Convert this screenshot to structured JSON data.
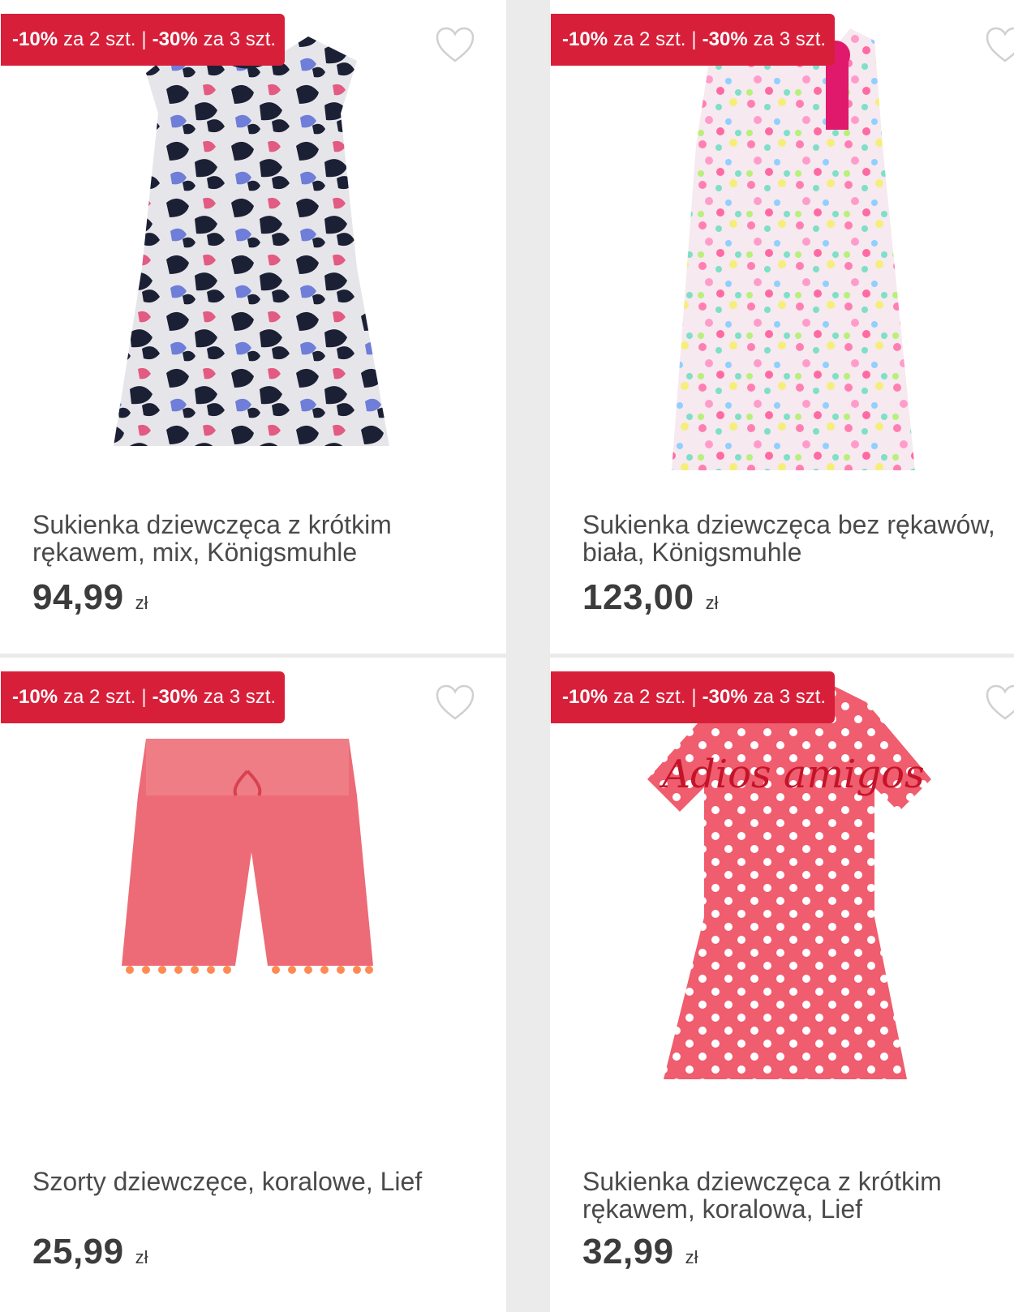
{
  "colors": {
    "badge": "#d81f3a",
    "background": "#ebebeb",
    "card": "#ffffff",
    "text": "#4a4a4a"
  },
  "products": [
    {
      "badge": {
        "d1": "-10%",
        "t1": "za 2 szt.",
        "sep": "|",
        "d2": "-30%",
        "t2": "za 3 szt."
      },
      "title_line1": "Sukienka dziewczęca z krótkim",
      "title_line2": "rękawem, mix, Königsmuhle",
      "price": "94,99",
      "currency": "zł",
      "image_icon": "butterfly-dress-image"
    },
    {
      "badge": {
        "d1": "-10%",
        "t1": "za 2 szt.",
        "sep": "|",
        "d2": "-30%",
        "t2": "za 3 szt."
      },
      "title_line1": "Sukienka dziewczęca bez rękawów,",
      "title_line2": "biała, Königsmuhle",
      "price": "123,00",
      "currency": "zł",
      "image_icon": "hearts-dress-image"
    },
    {
      "badge": {
        "d1": "-10%",
        "t1": "za 2 szt.",
        "sep": "|",
        "d2": "-30%",
        "t2": "za 3 szt."
      },
      "title_line1": "Szorty dziewczęce, koralowe, Lief",
      "title_line2": "",
      "price": "25,99",
      "currency": "zł",
      "image_icon": "coral-shorts-image"
    },
    {
      "badge": {
        "d1": "-10%",
        "t1": "za 2 szt.",
        "sep": "|",
        "d2": "-30%",
        "t2": "za 3 szt."
      },
      "title_line1": "Sukienka dziewczęca z krótkim",
      "title_line2": "rękawem, koralowa, Lief",
      "price": "32,99",
      "currency": "zł",
      "image_icon": "polka-dot-dress-image",
      "print_text": "Adios amigos"
    }
  ]
}
